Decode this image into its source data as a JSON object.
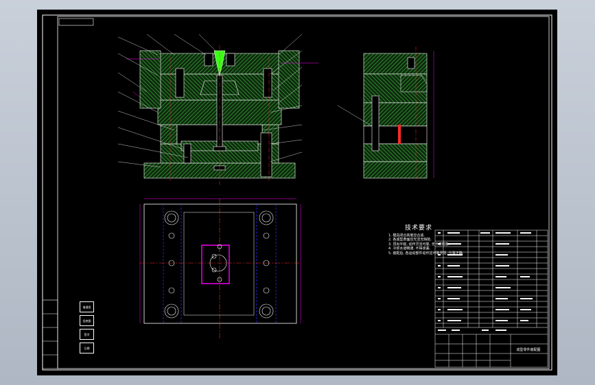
{
  "colors": {
    "background": "#000000",
    "frame": "#ffffff",
    "hatch": "#2e8b2e",
    "highlight": "#39ff14",
    "center_line": "#ff2a2a",
    "dimension": "#ff00ff",
    "hidden_line": "#2b2bff",
    "window_bg": "#b8c0cc"
  },
  "technical_requirements": {
    "title": "技术要求",
    "items": [
      "1. 模具闭合高度应合适.",
      "2. 各成型表面应光洁无缺陷.",
      "3. 顶出平稳, 动作灵活可靠, 无卡滞现象.",
      "4. 冷却水道畅通, 不得渗漏.",
      "5. 装配后, 各运动部件动作应可靠灵活, 位置正确."
    ]
  },
  "title_block": {
    "drawing_name": "成型零件装配图"
  },
  "side_labels": [
    "借通用",
    "旧底图",
    "签字",
    "日期"
  ]
}
